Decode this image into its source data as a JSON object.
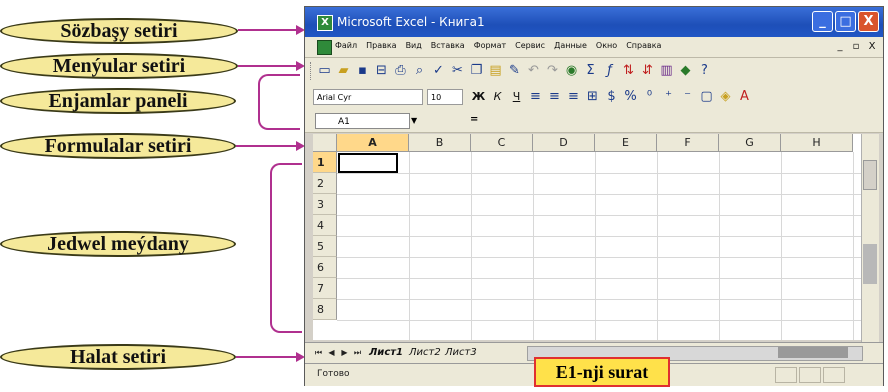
{
  "callouts": [
    {
      "label": "Sözbaşy setiri"
    },
    {
      "label": "Menýular setiri"
    },
    {
      "label": "Enjamlar paneli"
    },
    {
      "label": "Formulalar setiri"
    },
    {
      "label": "Jedwel meýdany"
    },
    {
      "label": "Halat setiri"
    }
  ],
  "window": {
    "title": "Microsoft Excel - Книга1",
    "minimize": "_",
    "maximize": "□",
    "close": "X"
  },
  "menu": {
    "items": [
      "Файл",
      "Правка",
      "Вид",
      "Вставка",
      "Формат",
      "Сервис",
      "Данные",
      "Окно",
      "Справка"
    ],
    "controls": [
      "_",
      "▫",
      "X"
    ]
  },
  "toolbar_standard": {
    "icons": [
      "new-icon",
      "open-icon",
      "save-icon",
      "permission-icon",
      "print-icon",
      "print-preview-icon",
      "spelling-icon",
      "cut-icon",
      "copy-icon",
      "paste-icon",
      "format-painter-icon",
      "undo-icon",
      "redo-icon",
      "hyperlink-icon",
      "autosum-icon",
      "function-icon",
      "sort-asc-icon",
      "sort-desc-icon",
      "chart-icon",
      "drawing-icon",
      "help-icon"
    ]
  },
  "toolbar_formatting": {
    "font": "Arial Cyr",
    "size": "10",
    "buttons": [
      "Ж",
      "К",
      "Ч"
    ]
  },
  "formula_bar": {
    "cell_ref": "A1",
    "equals": "="
  },
  "sheet": {
    "columns": [
      "A",
      "B",
      "C",
      "D",
      "E",
      "F",
      "G",
      "H"
    ],
    "rows": [
      "1",
      "2",
      "3",
      "4",
      "5",
      "6",
      "7",
      "8"
    ],
    "selected_column": "A",
    "selected_row": "1"
  },
  "tabs": {
    "nav": [
      "⏮",
      "◀",
      "▶",
      "⏭"
    ],
    "sheets": [
      "Лист1",
      "Лист2",
      "Лист3"
    ],
    "active": "Лист1"
  },
  "status": {
    "text": "Готово"
  },
  "caption": "E1-nji surat",
  "colors": {
    "callout_fill": "#f5e99a",
    "arrow": "#b0308f",
    "titlebar": "#1e4fb8",
    "caption_fill": "#ffe14a",
    "caption_border": "#e03030"
  }
}
